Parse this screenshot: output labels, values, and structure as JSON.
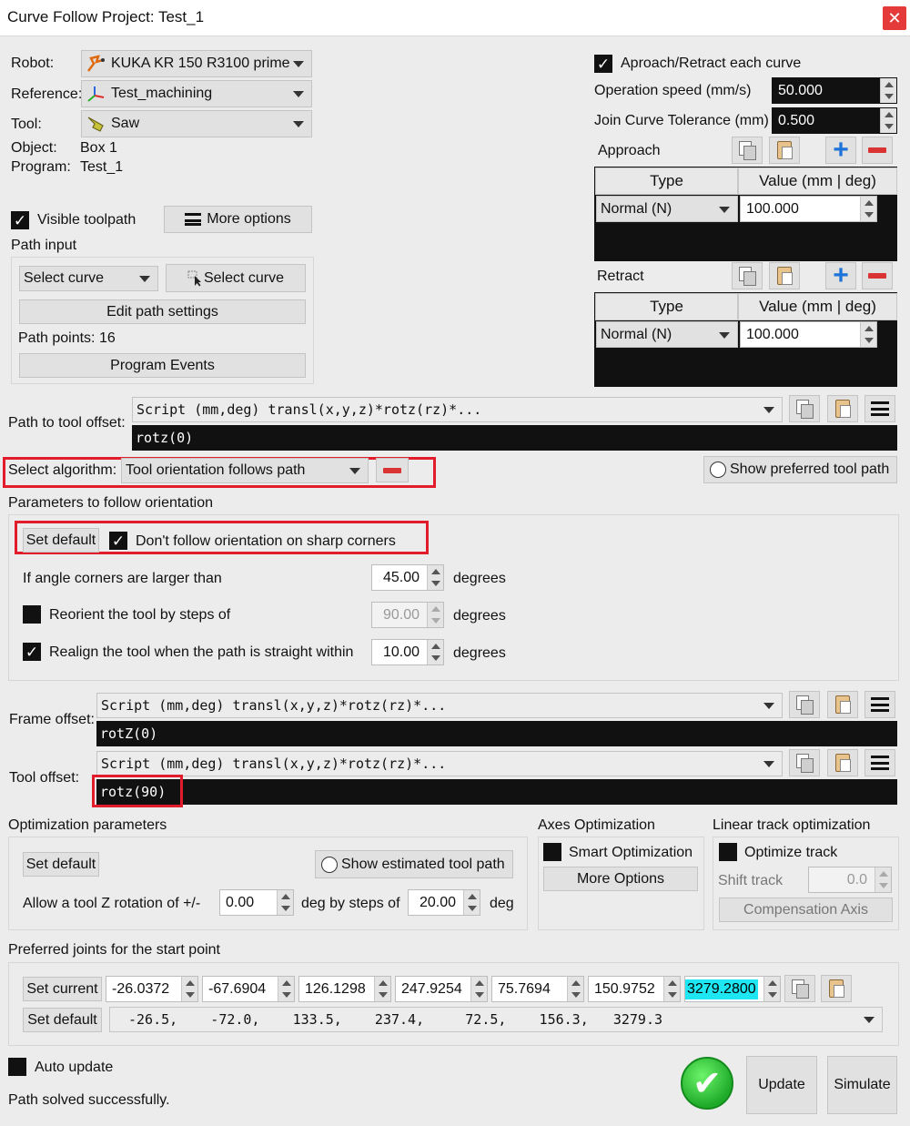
{
  "window": {
    "title": "Curve Follow Project: Test_1",
    "close_glyph": "✕"
  },
  "left_top": {
    "robot_label": "Robot:",
    "robot_value": "KUKA KR 150 R3100 prime",
    "reference_label": "Reference:",
    "reference_value": "Test_machining",
    "tool_label": "Tool:",
    "tool_value": "Saw",
    "object_label": "Object:",
    "object_value": "Box 1",
    "program_label": "Program:",
    "program_value": "Test_1"
  },
  "toolpath": {
    "visible_label": "Visible toolpath",
    "visible_checked": true,
    "more_options_label": "More options",
    "path_input_label": "Path input",
    "select_curve_combo": "Select curve",
    "select_curve_button": "Select curve",
    "edit_path_settings": "Edit path settings",
    "path_points": "Path points: 16",
    "program_events": "Program Events"
  },
  "right_top": {
    "approach_retract_label": "Aproach/Retract each curve",
    "approach_retract_checked": true,
    "operation_speed_label": "Operation speed (mm/s)",
    "operation_speed_value": "50.000",
    "join_tol_label": "Join Curve Tolerance (mm)",
    "join_tol_value": "0.500",
    "approach_label": "Approach",
    "retract_label": "Retract",
    "col_type": "Type",
    "col_value": "Value (mm | deg)",
    "approach_row": {
      "type": "Normal (N)",
      "value": "100.000"
    },
    "retract_row": {
      "type": "Normal (N)",
      "value": "100.000"
    }
  },
  "path_to_tool": {
    "label": "Path to tool offset:",
    "script": "Script (mm,deg) transl(x,y,z)*rotz(rz)*...",
    "value": "rotz(0)"
  },
  "algorithm": {
    "label": "Select algorithm:",
    "value": "Tool orientation follows path",
    "show_preferred": "Show preferred tool path"
  },
  "orientation": {
    "section_label": "Parameters to follow orientation",
    "set_default": "Set default",
    "dont_follow_label": "Don't follow orientation on sharp corners",
    "dont_follow_checked": true,
    "angle_label": "If angle corners are larger than",
    "angle_value": "45.00",
    "angle_unit": "degrees",
    "reorient_label": "Reorient the tool by steps of",
    "reorient_checked": false,
    "reorient_value": "90.00",
    "reorient_unit": "degrees",
    "realign_label": "Realign the tool when the path is straight within",
    "realign_checked": true,
    "realign_value": "10.00",
    "realign_unit": "degrees"
  },
  "frame_offset": {
    "label": "Frame offset:",
    "script": "Script (mm,deg) transl(x,y,z)*rotz(rz)*...",
    "value": "rotZ(0)"
  },
  "tool_offset": {
    "label": "Tool offset:",
    "script": "Script (mm,deg) transl(x,y,z)*rotz(rz)*...",
    "value": "rotz(90)"
  },
  "optimization": {
    "section_label": "Optimization parameters",
    "set_default": "Set default",
    "show_estimated": "Show estimated tool path",
    "allow_label": "Allow a tool Z rotation of +/-",
    "allow_value": "0.00",
    "steps_label": "deg by steps of",
    "steps_value": "20.00",
    "steps_unit": "deg"
  },
  "axes_opt": {
    "section_label": "Axes Optimization",
    "smart_label": "Smart Optimization",
    "smart_checked": false,
    "more_options": "More Options"
  },
  "linear_track": {
    "section_label": "Linear track optimization",
    "optimize_label": "Optimize track",
    "optimize_checked": false,
    "shift_label": "Shift track",
    "shift_value": "0.0",
    "compensation": "Compensation Axis"
  },
  "preferred_joints": {
    "section_label": "Preferred joints for the start point",
    "set_current": "Set current",
    "set_default": "Set default",
    "joints": [
      "-26.0372",
      "-67.6904",
      "126.1298",
      "247.9254",
      "75.7694",
      "150.9752",
      "3279.2800"
    ],
    "default_values": "-26.5,    -72.0,    133.5,    237.4,     72.5,    156.3,   3279.3"
  },
  "footer": {
    "auto_update_label": "Auto update",
    "auto_update_checked": false,
    "status": "Path solved successfully.",
    "ok_glyph": "✔",
    "update": "Update",
    "simulate": "Simulate"
  },
  "colors": {
    "accent_cyan": "#1ee6f3",
    "highlight_red": "#e21c2b",
    "success_green": "#1faa2a",
    "plus_blue": "#1e73d8"
  }
}
